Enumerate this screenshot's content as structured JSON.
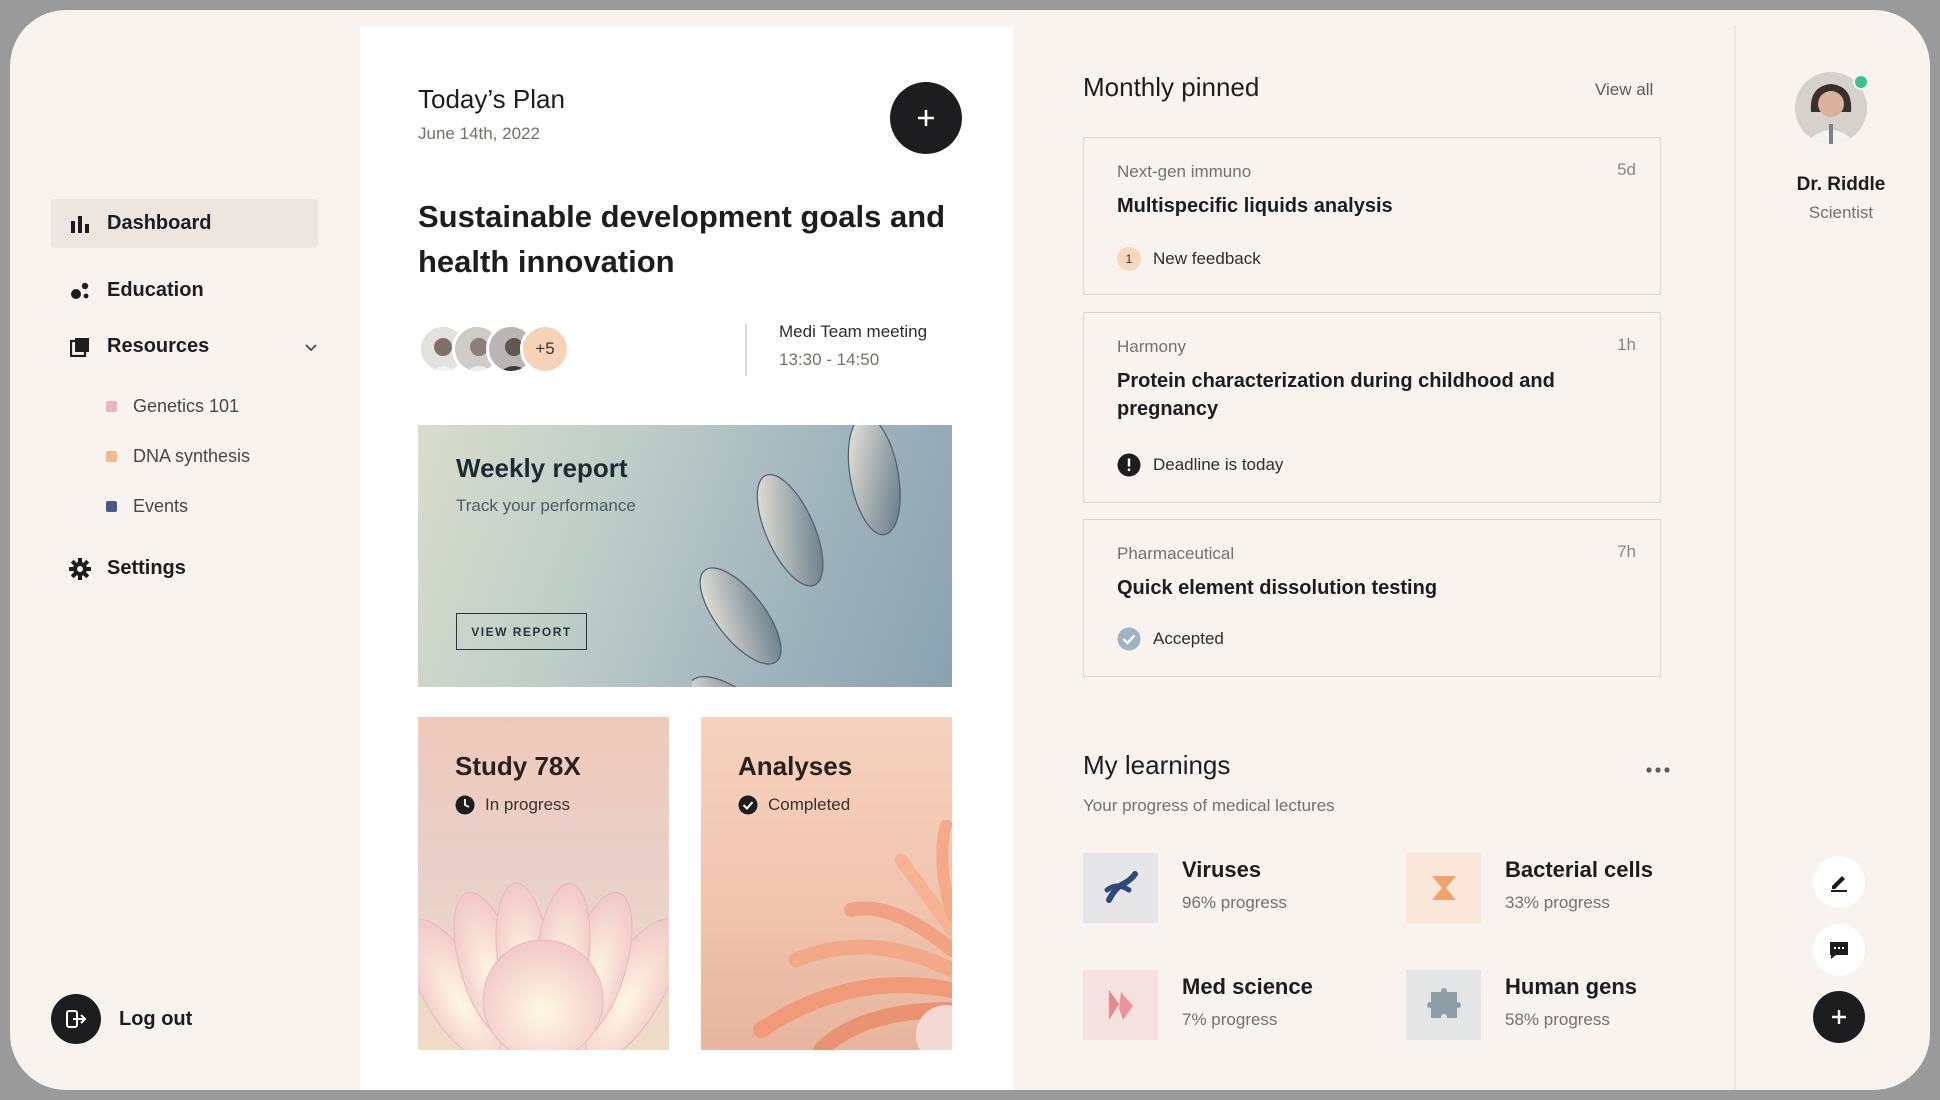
{
  "sidebar": {
    "items": [
      {
        "label": "Dashboard",
        "icon": "bar-chart-icon"
      },
      {
        "label": "Education",
        "icon": "molecule-icon"
      },
      {
        "label": "Resources",
        "icon": "stack-icon"
      },
      {
        "label": "Settings",
        "icon": "gear-icon"
      }
    ],
    "sub_items": [
      {
        "label": "Genetics 101",
        "color": "#eab6bd"
      },
      {
        "label": "DNA synthesis",
        "color": "#f2bc8b"
      },
      {
        "label": "Events",
        "color": "#4a5a86"
      }
    ],
    "logout_label": "Log out"
  },
  "plan": {
    "title": "Today’s Plan",
    "date": "June 14th, 2022",
    "headline": "Sustainable development goals and health innovation",
    "attendees_more": "+5",
    "meeting_name": "Medi Team meeting",
    "meeting_time": "13:30 - 14:50",
    "weekly": {
      "title": "Weekly report",
      "subtitle": "Track your performance",
      "button": "VIEW REPORT"
    },
    "cards": [
      {
        "title": "Study 78X",
        "status": "In progress",
        "status_icon": "clock-icon"
      },
      {
        "title": "Analyses",
        "status": "Completed",
        "status_icon": "check-circle-icon"
      }
    ]
  },
  "pinned": {
    "title": "Monthly pinned",
    "view_all": "View all",
    "items": [
      {
        "category": "Next-gen immuno",
        "time": "5d",
        "title": "Multispecific liquids analysis",
        "status": "New feedback",
        "badge": "1"
      },
      {
        "category": "Harmony",
        "time": "1h",
        "title": "Protein characterization during childhood and pregnancy",
        "status": "Deadline is today"
      },
      {
        "category": "Pharmaceutical",
        "time": "7h",
        "title": "Quick element dissolution testing",
        "status": "Accepted"
      }
    ]
  },
  "learnings": {
    "title": "My learnings",
    "subtitle": "Your progress of medical lectures",
    "items": [
      {
        "name": "Viruses",
        "progress": "96% progress",
        "value": 96,
        "color": "#2f4a7a",
        "bg": "#e6e6e8"
      },
      {
        "name": "Bacterial cells",
        "progress": "33% progress",
        "value": 33,
        "color": "#f2a36b",
        "bg": "#fbe7d9"
      },
      {
        "name": "Med science",
        "progress": "7% progress",
        "value": 7,
        "color": "#e58a8f",
        "bg": "#f6e1e1"
      },
      {
        "name": "Human gens",
        "progress": "58% progress",
        "value": 58,
        "color": "#8f9fa7",
        "bg": "#e4e6e5"
      }
    ]
  },
  "profile": {
    "name": "Dr. Riddle",
    "role": "Scientist",
    "status_color": "#3fc28a"
  }
}
